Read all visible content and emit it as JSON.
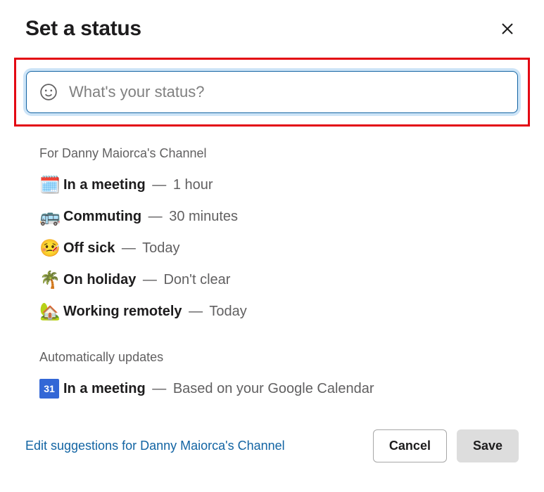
{
  "header": {
    "title": "Set a status"
  },
  "input": {
    "placeholder": "What's your status?"
  },
  "section1": {
    "label": "For Danny Maiorca's Channel",
    "items": [
      {
        "emoji": "🗓️",
        "label": "In a meeting",
        "duration": "1 hour"
      },
      {
        "emoji": "🚌",
        "label": "Commuting",
        "duration": "30 minutes"
      },
      {
        "emoji": "🤒",
        "label": "Off sick",
        "duration": "Today"
      },
      {
        "emoji": "🌴",
        "label": "On holiday",
        "duration": "Don't clear"
      },
      {
        "emoji": "🏡",
        "label": "Working remotely",
        "duration": "Today"
      }
    ]
  },
  "section2": {
    "label": "Automatically updates",
    "items": [
      {
        "icon": "calendar-31",
        "iconText": "31",
        "label": "In a meeting",
        "duration": "Based on your Google Calendar"
      }
    ]
  },
  "footer": {
    "editLink": "Edit suggestions for Danny Maiorca's Channel",
    "cancel": "Cancel",
    "save": "Save"
  },
  "dash": "—"
}
